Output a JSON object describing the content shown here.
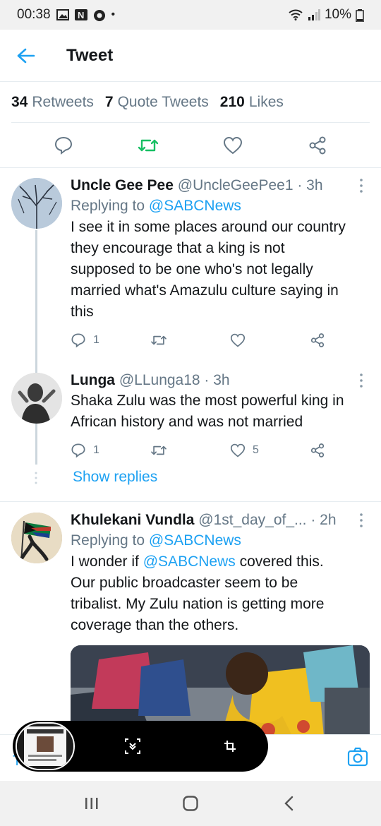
{
  "status_bar": {
    "time": "00:38",
    "battery": "10%"
  },
  "header": {
    "title": "Tweet"
  },
  "stats": {
    "retweets_count": "34",
    "retweets_label": "Retweets",
    "quotes_count": "7",
    "quotes_label": "Quote Tweets",
    "likes_count": "210",
    "likes_label": "Likes"
  },
  "replies": [
    {
      "name": "Uncle Gee Pee",
      "handle": "@UncleGeePee1 · 3h",
      "replying_prefix": "Replying to",
      "replying_to": "@SABCNews",
      "text_lines": [
        "I see it in some places around our country",
        "they encourage that a king is not",
        "supposed to be one who's not legally",
        "married what's Amazulu culture saying in",
        "this"
      ],
      "reply_count": "1",
      "retweet_count": "",
      "like_count": ""
    },
    {
      "name": "Lunga",
      "handle": "@LLunga18 · 3h",
      "text_lines": [
        "Shaka Zulu was the most powerful king in",
        "African history and was not married"
      ],
      "reply_count": "1",
      "retweet_count": "",
      "like_count": "5"
    },
    {
      "name": "Khulekani Vundla",
      "handle": "@1st_day_of_...",
      "time": "· 2h",
      "replying_prefix": "Replying to",
      "replying_to": "@SABCNews",
      "text_prefix": "I wonder if",
      "text_mention": "@SABCNews",
      "text_suffix": "covered this.",
      "text_lines": [
        "Our public broadcaster seem to be",
        "tribalist. My Zulu nation is getting more",
        "coverage than the others."
      ]
    }
  ],
  "show_replies": "Show replies",
  "compose": {
    "char": "T"
  },
  "colors": {
    "accent": "#1da1f2",
    "retweet_green": "#17bf63",
    "muted": "#657786"
  }
}
